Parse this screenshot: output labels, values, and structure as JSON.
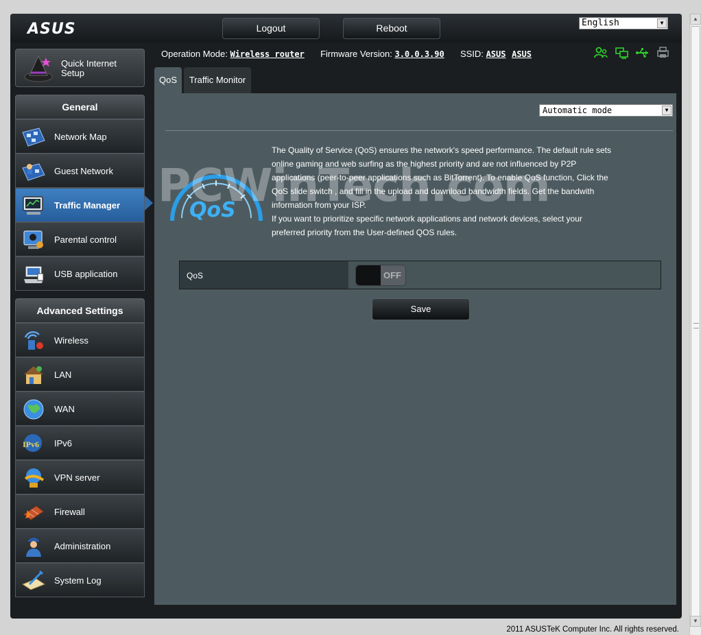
{
  "header": {
    "logo": "ASUS",
    "logout_label": "Logout",
    "reboot_label": "Reboot",
    "language": "English"
  },
  "status": {
    "operation_mode_label": "Operation Mode:",
    "operation_mode_value": "Wireless router",
    "firmware_label": "Firmware Version:",
    "firmware_value": "3.0.0.3.90",
    "ssid_label": "SSID:",
    "ssid_1": "ASUS",
    "ssid_2": "ASUS",
    "icons": [
      "clients-icon",
      "network-icon",
      "usb-icon",
      "printer-icon"
    ]
  },
  "sidebar": {
    "quick_setup_label": "Quick Internet Setup",
    "general_header": "General",
    "general_items": [
      {
        "label": "Network Map",
        "icon": "network-map-icon"
      },
      {
        "label": "Guest Network",
        "icon": "guest-network-icon"
      },
      {
        "label": "Traffic Manager",
        "icon": "traffic-manager-icon",
        "active": true
      },
      {
        "label": "Parental control",
        "icon": "parental-control-icon"
      },
      {
        "label": "USB application",
        "icon": "usb-application-icon"
      }
    ],
    "advanced_header": "Advanced Settings",
    "advanced_items": [
      {
        "label": "Wireless",
        "icon": "wireless-icon"
      },
      {
        "label": "LAN",
        "icon": "lan-icon"
      },
      {
        "label": "WAN",
        "icon": "wan-icon"
      },
      {
        "label": "IPv6",
        "icon": "ipv6-icon"
      },
      {
        "label": "VPN server",
        "icon": "vpn-server-icon"
      },
      {
        "label": "Firewall",
        "icon": "firewall-icon"
      },
      {
        "label": "Administration",
        "icon": "administration-icon"
      },
      {
        "label": "System Log",
        "icon": "system-log-icon"
      }
    ]
  },
  "tabs": {
    "qos": "QoS",
    "traffic_monitor": "Traffic Monitor"
  },
  "main": {
    "mode_select": "Automatic mode",
    "qos_logo_text": "QoS",
    "watermark": "PCWinTech.com",
    "description_1": "The Quality of Service (QoS) ensures the network's speed performance. The default rule sets online gaming and web surfing as the highest priority and are not influenced by P2P applications (peer-to-peer applications such as BitTorrent). To enable QoS function, Click the QoS slide switch , and fill in the upload and download bandwidth fields. Get the bandwith information from your ISP.",
    "description_2": "If you want to prioritize specific network applications and network devices, select your preferred priority from the User-defined QOS rules.",
    "qos_row_label": "QoS",
    "qos_toggle": "OFF",
    "save_label": "Save"
  },
  "footer": {
    "copyright": "2011 ASUSTeK Computer Inc. All rights reserved."
  },
  "colors": {
    "accent": "#2f6cac",
    "content_bg": "#4d5b60",
    "frame_bg": "#1b1e20",
    "status_icons": "#2ed12e"
  }
}
